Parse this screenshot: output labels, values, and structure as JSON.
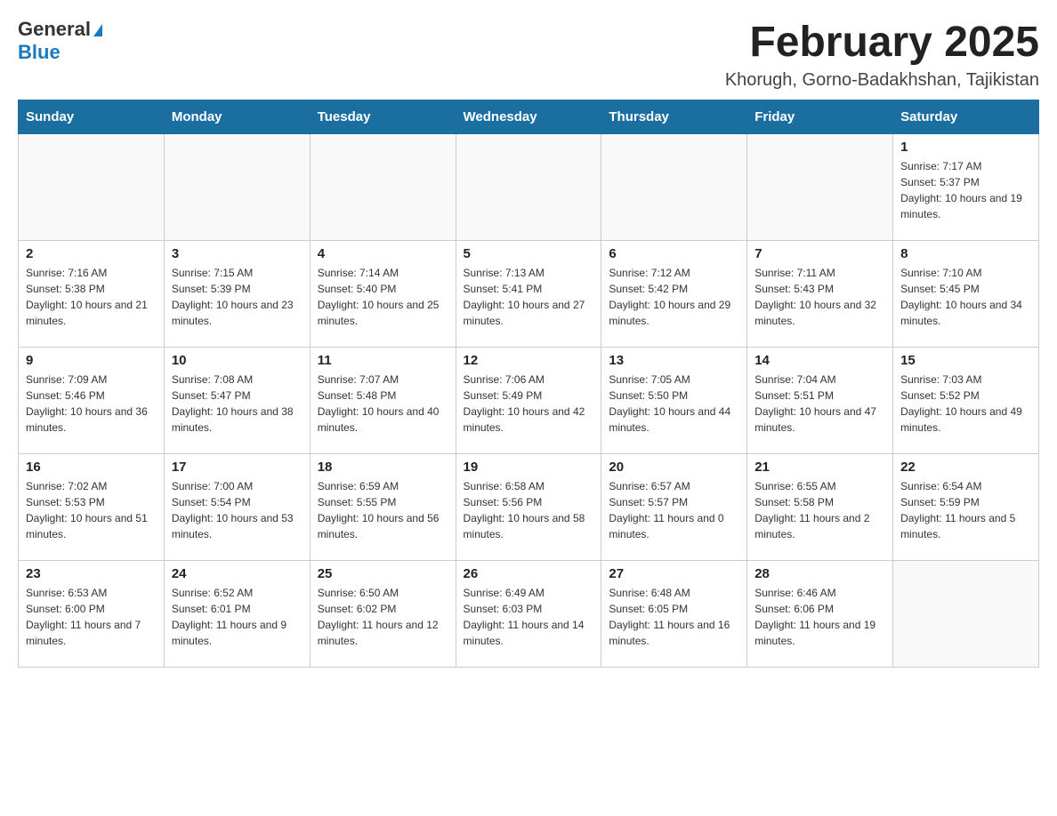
{
  "header": {
    "logo_general": "General",
    "logo_blue": "Blue",
    "title": "February 2025",
    "subtitle": "Khorugh, Gorno-Badakhshan, Tajikistan"
  },
  "days_of_week": [
    "Sunday",
    "Monday",
    "Tuesday",
    "Wednesday",
    "Thursday",
    "Friday",
    "Saturday"
  ],
  "weeks": [
    [
      {
        "day": "",
        "info": ""
      },
      {
        "day": "",
        "info": ""
      },
      {
        "day": "",
        "info": ""
      },
      {
        "day": "",
        "info": ""
      },
      {
        "day": "",
        "info": ""
      },
      {
        "day": "",
        "info": ""
      },
      {
        "day": "1",
        "info": "Sunrise: 7:17 AM\nSunset: 5:37 PM\nDaylight: 10 hours and 19 minutes."
      }
    ],
    [
      {
        "day": "2",
        "info": "Sunrise: 7:16 AM\nSunset: 5:38 PM\nDaylight: 10 hours and 21 minutes."
      },
      {
        "day": "3",
        "info": "Sunrise: 7:15 AM\nSunset: 5:39 PM\nDaylight: 10 hours and 23 minutes."
      },
      {
        "day": "4",
        "info": "Sunrise: 7:14 AM\nSunset: 5:40 PM\nDaylight: 10 hours and 25 minutes."
      },
      {
        "day": "5",
        "info": "Sunrise: 7:13 AM\nSunset: 5:41 PM\nDaylight: 10 hours and 27 minutes."
      },
      {
        "day": "6",
        "info": "Sunrise: 7:12 AM\nSunset: 5:42 PM\nDaylight: 10 hours and 29 minutes."
      },
      {
        "day": "7",
        "info": "Sunrise: 7:11 AM\nSunset: 5:43 PM\nDaylight: 10 hours and 32 minutes."
      },
      {
        "day": "8",
        "info": "Sunrise: 7:10 AM\nSunset: 5:45 PM\nDaylight: 10 hours and 34 minutes."
      }
    ],
    [
      {
        "day": "9",
        "info": "Sunrise: 7:09 AM\nSunset: 5:46 PM\nDaylight: 10 hours and 36 minutes."
      },
      {
        "day": "10",
        "info": "Sunrise: 7:08 AM\nSunset: 5:47 PM\nDaylight: 10 hours and 38 minutes."
      },
      {
        "day": "11",
        "info": "Sunrise: 7:07 AM\nSunset: 5:48 PM\nDaylight: 10 hours and 40 minutes."
      },
      {
        "day": "12",
        "info": "Sunrise: 7:06 AM\nSunset: 5:49 PM\nDaylight: 10 hours and 42 minutes."
      },
      {
        "day": "13",
        "info": "Sunrise: 7:05 AM\nSunset: 5:50 PM\nDaylight: 10 hours and 44 minutes."
      },
      {
        "day": "14",
        "info": "Sunrise: 7:04 AM\nSunset: 5:51 PM\nDaylight: 10 hours and 47 minutes."
      },
      {
        "day": "15",
        "info": "Sunrise: 7:03 AM\nSunset: 5:52 PM\nDaylight: 10 hours and 49 minutes."
      }
    ],
    [
      {
        "day": "16",
        "info": "Sunrise: 7:02 AM\nSunset: 5:53 PM\nDaylight: 10 hours and 51 minutes."
      },
      {
        "day": "17",
        "info": "Sunrise: 7:00 AM\nSunset: 5:54 PM\nDaylight: 10 hours and 53 minutes."
      },
      {
        "day": "18",
        "info": "Sunrise: 6:59 AM\nSunset: 5:55 PM\nDaylight: 10 hours and 56 minutes."
      },
      {
        "day": "19",
        "info": "Sunrise: 6:58 AM\nSunset: 5:56 PM\nDaylight: 10 hours and 58 minutes."
      },
      {
        "day": "20",
        "info": "Sunrise: 6:57 AM\nSunset: 5:57 PM\nDaylight: 11 hours and 0 minutes."
      },
      {
        "day": "21",
        "info": "Sunrise: 6:55 AM\nSunset: 5:58 PM\nDaylight: 11 hours and 2 minutes."
      },
      {
        "day": "22",
        "info": "Sunrise: 6:54 AM\nSunset: 5:59 PM\nDaylight: 11 hours and 5 minutes."
      }
    ],
    [
      {
        "day": "23",
        "info": "Sunrise: 6:53 AM\nSunset: 6:00 PM\nDaylight: 11 hours and 7 minutes."
      },
      {
        "day": "24",
        "info": "Sunrise: 6:52 AM\nSunset: 6:01 PM\nDaylight: 11 hours and 9 minutes."
      },
      {
        "day": "25",
        "info": "Sunrise: 6:50 AM\nSunset: 6:02 PM\nDaylight: 11 hours and 12 minutes."
      },
      {
        "day": "26",
        "info": "Sunrise: 6:49 AM\nSunset: 6:03 PM\nDaylight: 11 hours and 14 minutes."
      },
      {
        "day": "27",
        "info": "Sunrise: 6:48 AM\nSunset: 6:05 PM\nDaylight: 11 hours and 16 minutes."
      },
      {
        "day": "28",
        "info": "Sunrise: 6:46 AM\nSunset: 6:06 PM\nDaylight: 11 hours and 19 minutes."
      },
      {
        "day": "",
        "info": ""
      }
    ]
  ]
}
